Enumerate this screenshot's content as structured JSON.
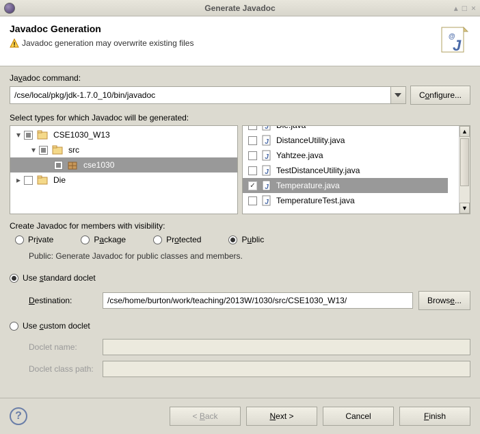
{
  "window": {
    "title": "Generate Javadoc",
    "minimize": "_",
    "maximize": "□",
    "close": "×"
  },
  "header": {
    "title": "Javadoc Generation",
    "warning": "Javadoc generation may overwrite existing files"
  },
  "javadoc_command": {
    "label": "Javadoc command:",
    "value": "/cse/local/pkg/jdk-1.7.0_10/bin/javadoc",
    "configure_btn": "Configure..."
  },
  "types": {
    "label": "Select types for which Javadoc will be generated:",
    "tree": [
      {
        "indent": 0,
        "expanded": true,
        "check": "intermediate",
        "icon": "project",
        "label": "CSE1030_W13"
      },
      {
        "indent": 1,
        "expanded": true,
        "check": "intermediate",
        "icon": "folder",
        "label": "src"
      },
      {
        "indent": 2,
        "expanded": null,
        "check": "intermediate",
        "icon": "package",
        "label": "cse1030",
        "selected": true
      },
      {
        "indent": 0,
        "expanded": false,
        "check": "empty",
        "icon": "project",
        "label": "Die"
      }
    ],
    "files": [
      {
        "check": false,
        "label": "Die.java",
        "clipped": true
      },
      {
        "check": false,
        "label": "DistanceUtility.java"
      },
      {
        "check": false,
        "label": "Yahtzee.java"
      },
      {
        "check": false,
        "label": "TestDistanceUtility.java"
      },
      {
        "check": true,
        "label": "Temperature.java",
        "selected": true
      },
      {
        "check": false,
        "label": "TemperatureTest.java"
      }
    ]
  },
  "visibility": {
    "label": "Create Javadoc for members with visibility:",
    "options": {
      "private": "Private",
      "package": "Package",
      "protected": "Protected",
      "public": "Public"
    },
    "selected": "public",
    "description": "Public: Generate Javadoc for public classes and members."
  },
  "doclet": {
    "standard_label": "Use standard doclet",
    "destination_label": "Destination:",
    "destination_value": "/cse/home/burton/work/teaching/2013W/1030/src/CSE1030_W13/",
    "browse_btn": "Browse...",
    "custom_label": "Use custom doclet",
    "doclet_name_label": "Doclet name:",
    "doclet_name_value": "",
    "doclet_class_label": "Doclet class path:",
    "doclet_class_value": "",
    "selected": "standard"
  },
  "footer": {
    "back": "< Back",
    "next": "Next >",
    "cancel": "Cancel",
    "finish": "Finish"
  }
}
